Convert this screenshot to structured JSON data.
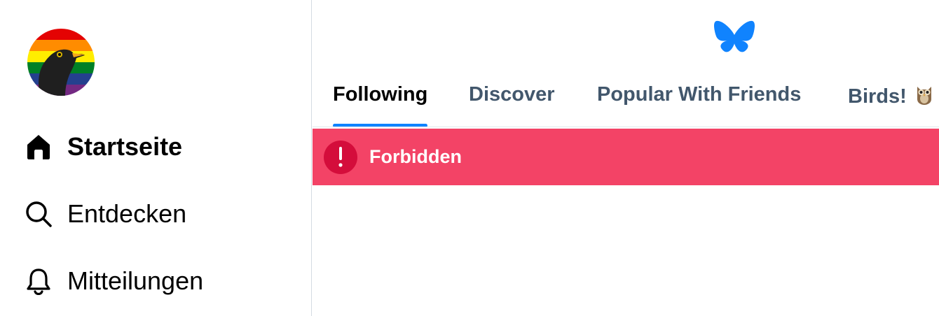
{
  "sidebar": {
    "avatar_icon": "user-avatar-blackbird-rainbow",
    "items": [
      {
        "label": "Startseite",
        "icon": "home-icon",
        "active": true
      },
      {
        "label": "Entdecken",
        "icon": "search-icon",
        "active": false
      },
      {
        "label": "Mitteilungen",
        "icon": "bell-icon",
        "active": false
      }
    ]
  },
  "header": {
    "logo_icon": "butterfly-logo-icon"
  },
  "feed_tabs": [
    {
      "label": "Following",
      "active": true
    },
    {
      "label": "Discover",
      "active": false
    },
    {
      "label": "Popular With Friends",
      "active": false
    },
    {
      "label": "Birds!",
      "emoji_icon": "owl-icon",
      "active": false
    }
  ],
  "error": {
    "icon": "exclamation-icon",
    "message": "Forbidden"
  },
  "colors": {
    "accent": "#1083fe",
    "error_background": "#f34366",
    "error_icon_background": "#d40d3b",
    "tab_inactive_text": "#42576c",
    "divider": "#d4dbe2"
  }
}
